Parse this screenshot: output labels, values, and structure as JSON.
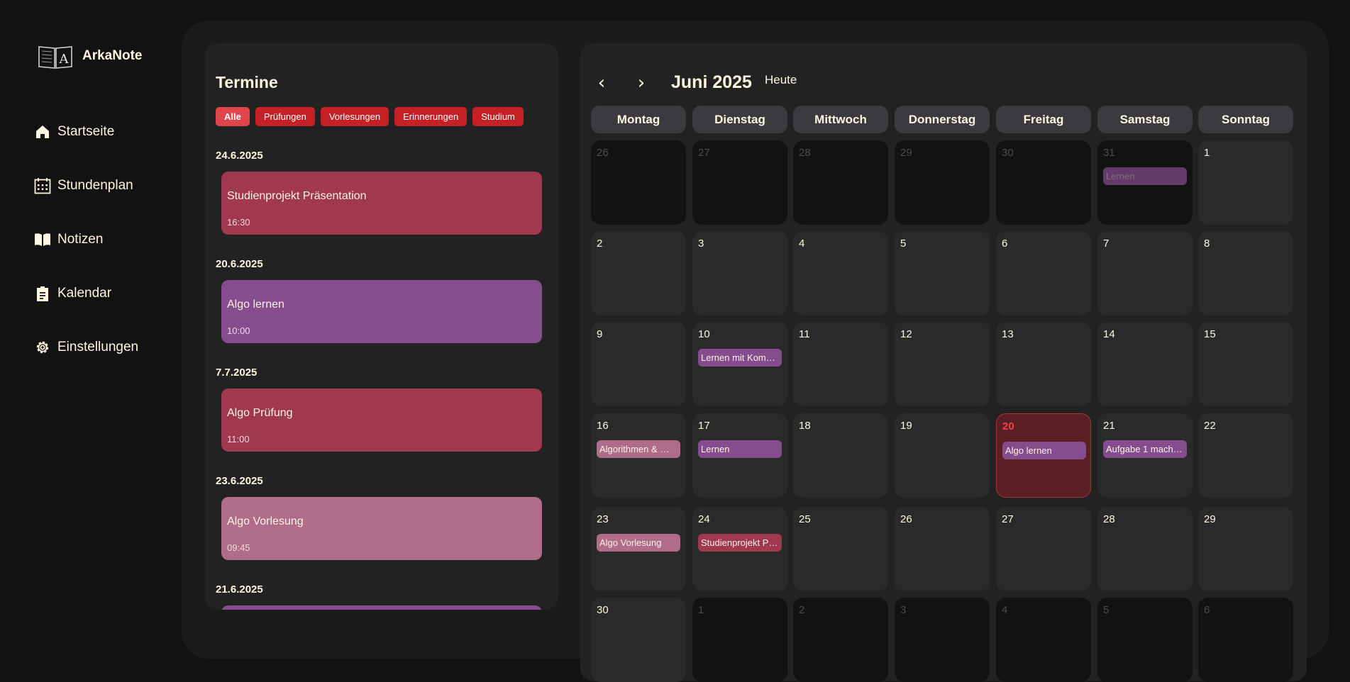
{
  "app": {
    "name": "ArkaNote",
    "logo_icon": "open-book-logo"
  },
  "nav": [
    {
      "label": "Startseite",
      "icon": "home-icon"
    },
    {
      "label": "Stundenplan",
      "icon": "calendar-grid-icon"
    },
    {
      "label": "Notizen",
      "icon": "book-icon"
    },
    {
      "label": "Kalendar",
      "icon": "clipboard-icon"
    },
    {
      "label": "Einstellungen",
      "icon": "gear-icon"
    }
  ],
  "termine": {
    "title": "Termine",
    "filters": [
      "Alle",
      "Prüfungen",
      "Vorlesungen",
      "Erinnerungen",
      "Studium"
    ],
    "active_filter": "Alle",
    "groups": [
      {
        "date": "24.6.2025",
        "title": "Studienprojekt Präsentation",
        "time": "16:30",
        "color": "#a0384e"
      },
      {
        "date": "20.6.2025",
        "title": "Algo lernen",
        "time": "10:00",
        "color": "#864d8e"
      },
      {
        "date": "7.7.2025",
        "title": "Algo Prüfung",
        "time": "11:00",
        "color": "#a0384e"
      },
      {
        "date": "23.6.2025",
        "title": "Algo Vorlesung",
        "time": "09:45",
        "color": "#b06d8a"
      },
      {
        "date": "21.6.2025",
        "title": "",
        "time": "",
        "color": "#864d8e"
      }
    ]
  },
  "calendar": {
    "month_label": "Juni 2025",
    "today_label": "Heute",
    "prev_icon": "‹",
    "next_icon": "›",
    "weekdays": [
      "Montag",
      "Dienstag",
      "Mittwoch",
      "Donnerstag",
      "Freitag",
      "Samstag",
      "Sonntag"
    ],
    "today": "20",
    "colors": {
      "lernen": "#864d8e",
      "vorlesung": "#b06d8a",
      "pruefung": "#a0384e",
      "today_bg": "#5a1f22",
      "accent": "#ff3d4a"
    },
    "weeks": [
      [
        {
          "d": "26",
          "other": true
        },
        {
          "d": "27",
          "other": true
        },
        {
          "d": "28",
          "other": true
        },
        {
          "d": "29",
          "other": true
        },
        {
          "d": "30",
          "other": true
        },
        {
          "d": "31",
          "other": true,
          "ev": "Lernen",
          "c": "#864d8e"
        },
        {
          "d": "1"
        }
      ],
      [
        {
          "d": "2"
        },
        {
          "d": "3"
        },
        {
          "d": "4"
        },
        {
          "d": "5"
        },
        {
          "d": "6"
        },
        {
          "d": "7"
        },
        {
          "d": "8"
        }
      ],
      [
        {
          "d": "9"
        },
        {
          "d": "10",
          "ev": "Lernen mit Kom…",
          "c": "#864d8e"
        },
        {
          "d": "11"
        },
        {
          "d": "12"
        },
        {
          "d": "13"
        },
        {
          "d": "14"
        },
        {
          "d": "15"
        }
      ],
      [
        {
          "d": "16",
          "ev": "Algorithmen & …",
          "c": "#b06d8a"
        },
        {
          "d": "17",
          "ev": "Lernen",
          "c": "#864d8e"
        },
        {
          "d": "18"
        },
        {
          "d": "19"
        },
        {
          "d": "20",
          "today": true,
          "ev": "Algo lernen",
          "c": "#864d8e"
        },
        {
          "d": "21",
          "ev": "Aufgabe 1 mach…",
          "c": "#864d8e"
        },
        {
          "d": "22"
        }
      ],
      [
        {
          "d": "23",
          "ev": "Algo Vorlesung",
          "c": "#b06d8a"
        },
        {
          "d": "24",
          "ev": "Studienprojekt P…",
          "c": "#a0384e"
        },
        {
          "d": "25"
        },
        {
          "d": "26"
        },
        {
          "d": "27"
        },
        {
          "d": "28"
        },
        {
          "d": "29"
        }
      ],
      [
        {
          "d": "30"
        },
        {
          "d": "1",
          "other": true
        },
        {
          "d": "2",
          "other": true
        },
        {
          "d": "3",
          "other": true
        },
        {
          "d": "4",
          "other": true
        },
        {
          "d": "5",
          "other": true
        },
        {
          "d": "6",
          "other": true
        }
      ]
    ]
  }
}
